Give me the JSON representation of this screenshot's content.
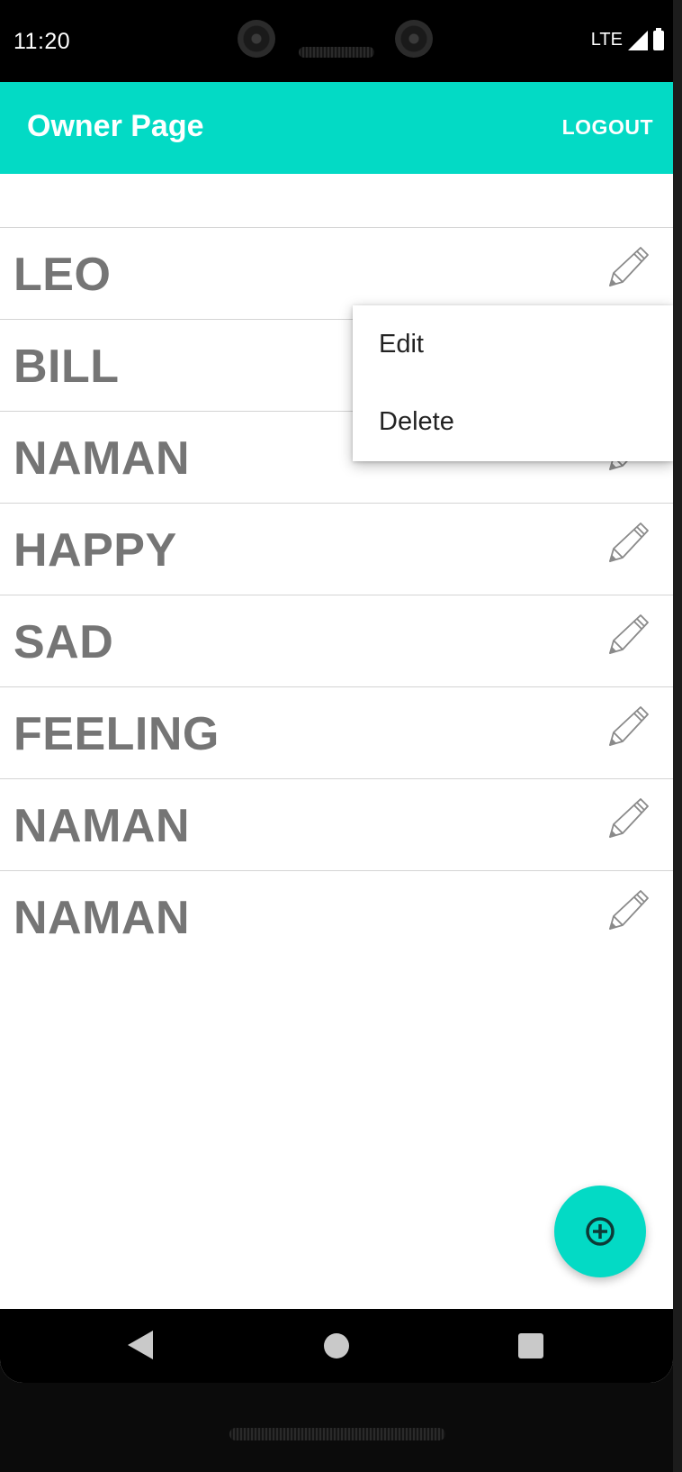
{
  "status_bar": {
    "time": "11:20",
    "network": "LTE",
    "signal_icon": "cell-signal-icon",
    "battery_icon": "battery-full-icon"
  },
  "app_bar": {
    "title": "Owner Page",
    "logout_label": "LOGOUT",
    "color": "#03dac5"
  },
  "list": {
    "items": [
      {
        "name": "LEO",
        "action_icon": "pencil-icon"
      },
      {
        "name": "BILL",
        "action_icon": "pencil-icon"
      },
      {
        "name": "NAMAN",
        "action_icon": "pencil-icon"
      },
      {
        "name": "HAPPY",
        "action_icon": "pencil-icon"
      },
      {
        "name": "SAD",
        "action_icon": "pencil-icon"
      },
      {
        "name": "FEELING",
        "action_icon": "pencil-icon"
      },
      {
        "name": "NAMAN",
        "action_icon": "pencil-icon"
      },
      {
        "name": "NAMAN",
        "action_icon": "pencil-icon"
      }
    ]
  },
  "popup_menu": {
    "items": [
      {
        "label": "Edit"
      },
      {
        "label": "Delete"
      }
    ]
  },
  "fab": {
    "icon": "add-circle-icon",
    "color": "#03dac5"
  },
  "nav_bar": {
    "back_icon": "back-triangle-icon",
    "home_icon": "home-circle-icon",
    "recents_icon": "recents-square-icon"
  }
}
